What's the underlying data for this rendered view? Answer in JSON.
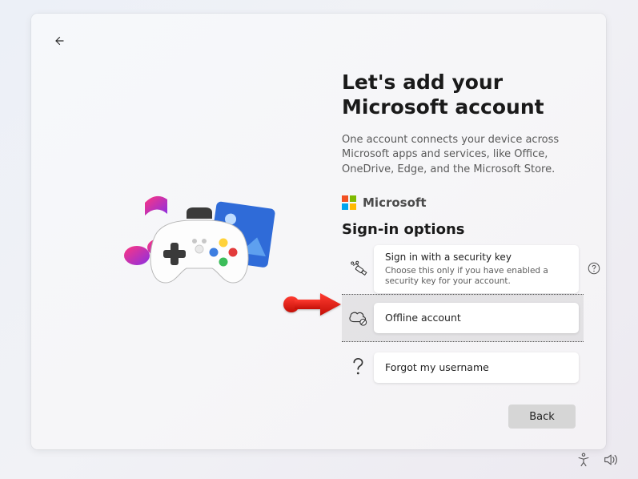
{
  "page": {
    "title": "Let's add your Microsoft account",
    "subtitle": "One account connects your device across Microsoft apps and services, like Office, OneDrive, Edge, and the Microsoft Store.",
    "brand": "Microsoft",
    "signin_heading": "Sign-in options"
  },
  "options": {
    "security_key": {
      "title": "Sign in with a security key",
      "desc": "Choose this only if you have enabled a security key for your account."
    },
    "offline": {
      "title": "Offline account"
    },
    "forgot": {
      "title": "Forgot my username"
    }
  },
  "footer": {
    "back_label": "Back"
  }
}
